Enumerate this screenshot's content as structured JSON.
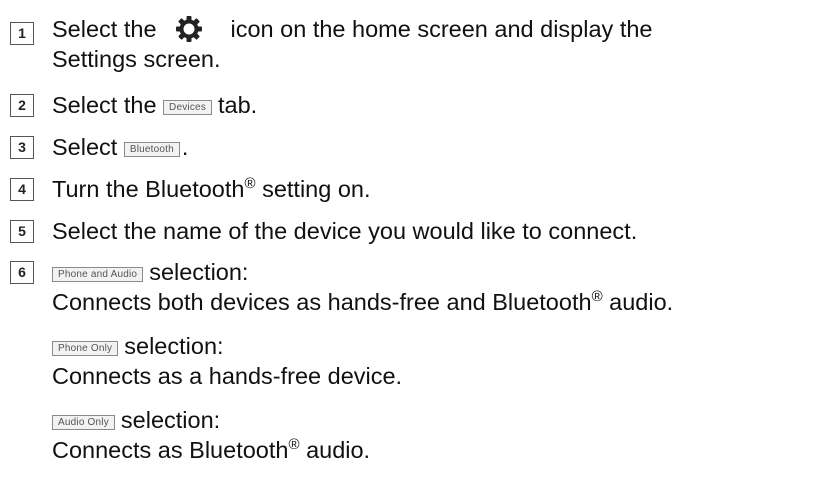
{
  "steps": [
    {
      "number": "1",
      "pre": "Select the",
      "icon": "gear-icon",
      "post": "icon on the home screen and display the",
      "line2": "Settings screen."
    },
    {
      "number": "2",
      "pre": "Select the",
      "button": "Devices",
      "post": "tab."
    },
    {
      "number": "3",
      "pre": "Select",
      "button": "Bluetooth",
      "post": "."
    },
    {
      "number": "4",
      "pre": "Turn the Bluetooth",
      "mark": "®",
      "post": "setting on."
    },
    {
      "number": "5",
      "text": "Select the name of the device you would like to connect."
    },
    {
      "number": "6",
      "options": [
        {
          "button": "Phone and Audio",
          "label": "selection:",
          "desc_pre": "Connects both devices as hands-free and Bluetooth",
          "desc_mark": "®",
          "desc_post": "audio."
        },
        {
          "button": "Phone Only",
          "label": "selection:",
          "desc": "Connects as a hands-free device."
        },
        {
          "button": "Audio Only",
          "label": "selection:",
          "desc_pre": "Connects as Bluetooth",
          "desc_mark": "®",
          "desc_post": "audio."
        }
      ]
    }
  ]
}
